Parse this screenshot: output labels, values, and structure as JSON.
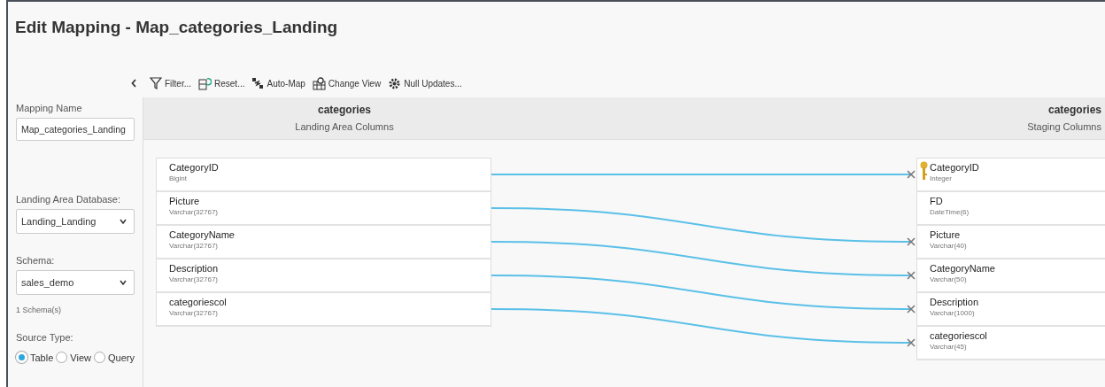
{
  "window": {
    "title": "Edit Mapping - Map_categories_Landing"
  },
  "toolbar": [
    {
      "label": "Filter...",
      "kind": "filter"
    },
    {
      "label": "Reset...",
      "kind": "reset"
    },
    {
      "label": "Auto-Map",
      "kind": "automap"
    },
    {
      "label": "Change View",
      "kind": "view"
    },
    {
      "label": "Null Updates...",
      "kind": "gear"
    }
  ],
  "sidebar": {
    "mapping_name": {
      "label": "Mapping Name",
      "value": "Map_categories_Landing"
    },
    "landing_database": {
      "label": "Landing Area Database:",
      "value": "Landing_Landing"
    },
    "schema": {
      "label": "Schema:",
      "value": "sales_demo",
      "note": "1 Schema(s)"
    },
    "source_type": {
      "label": "Source Type:",
      "options": [
        {
          "label": "Table",
          "selected": true
        },
        {
          "label": "View",
          "selected": false
        },
        {
          "label": "Query",
          "selected": false
        }
      ]
    }
  },
  "source_table": {
    "name": "categories",
    "subtitle": "Landing Area Columns",
    "columns": [
      {
        "name": "CategoryID",
        "type": "Bigint"
      },
      {
        "name": "Picture",
        "type": "Varchar(32767)"
      },
      {
        "name": "CategoryName",
        "type": "Varchar(32767)"
      },
      {
        "name": "Description",
        "type": "Varchar(32767)"
      },
      {
        "name": "categoriescol",
        "type": "Varchar(32767)"
      }
    ]
  },
  "target_table": {
    "name": "categories",
    "subtitle": "Staging Columns",
    "columns": [
      {
        "name": "CategoryID",
        "type": "Integer",
        "key": true,
        "mapped": true
      },
      {
        "name": "FD",
        "type": "DateTime(6)",
        "key": false,
        "mapped": false
      },
      {
        "name": "Picture",
        "type": "Varchar(40)",
        "key": false,
        "mapped": true
      },
      {
        "name": "CategoryName",
        "type": "Varchar(50)",
        "key": false,
        "mapped": true
      },
      {
        "name": "Description",
        "type": "Varchar(1000)",
        "key": false,
        "mapped": true
      },
      {
        "name": "categoriescol",
        "type": "Varchar(45)",
        "key": false,
        "mapped": true
      }
    ]
  }
}
